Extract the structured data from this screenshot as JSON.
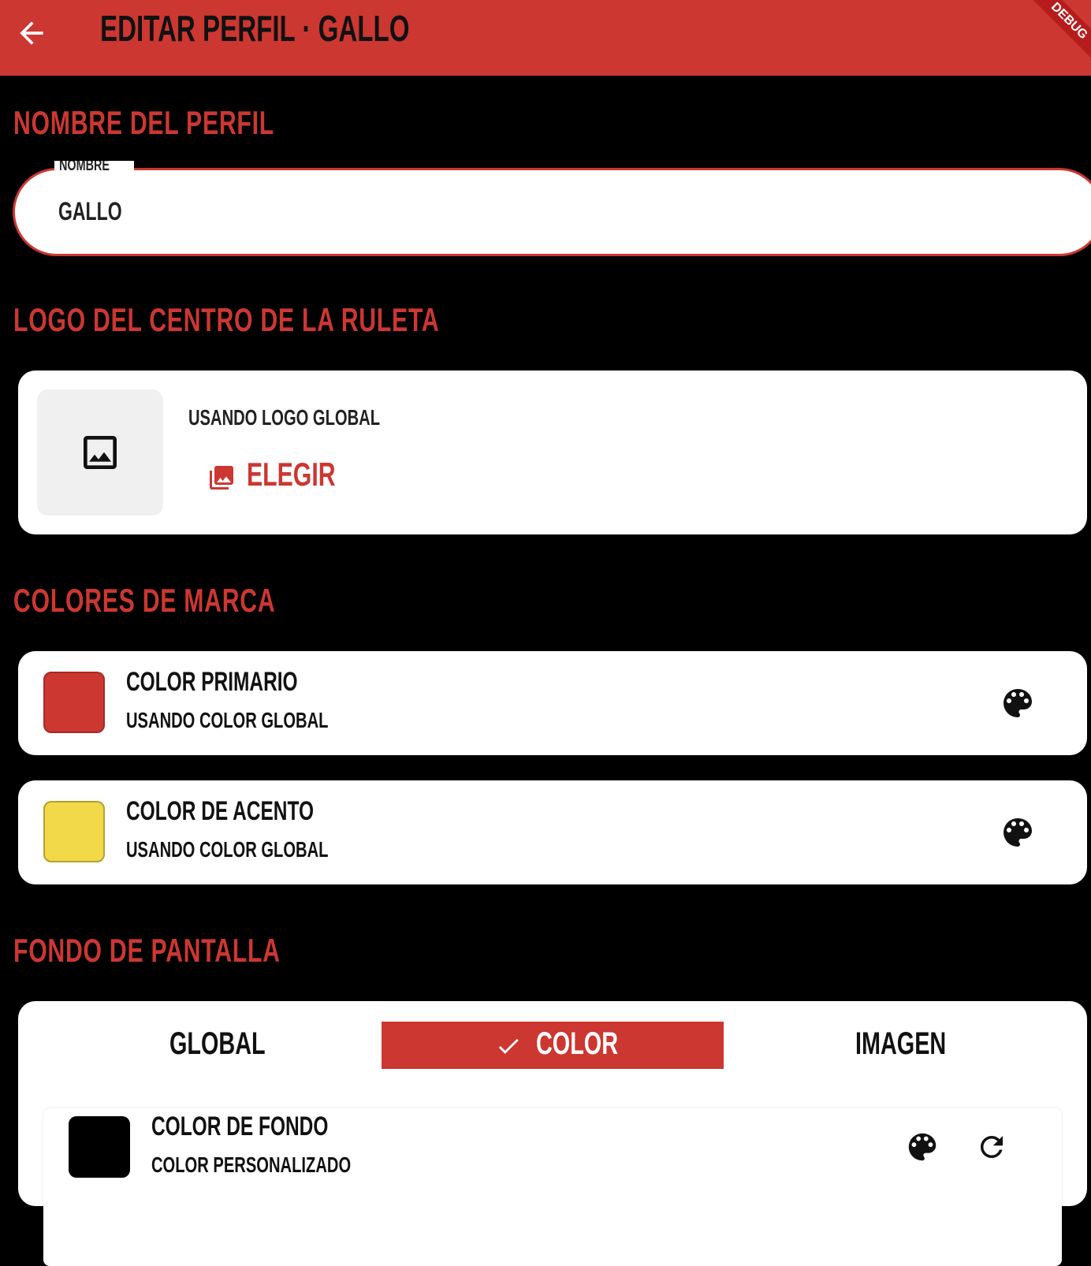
{
  "appbar": {
    "title": "EDITAR PERFIL · GALLO",
    "debug_banner": "DEBUG",
    "color": "#cc3731"
  },
  "sections": {
    "name": "NOMBRE DEL PERFIL",
    "logo": "LOGO DEL CENTRO DE LA RULETA",
    "colors": "COLORES DE MARCA",
    "background": "FONDO DE PANTALLA"
  },
  "name_field": {
    "label": "NOMBRE",
    "value": "GALLO"
  },
  "logo_card": {
    "status": "USANDO LOGO GLOBAL",
    "choose_label": "ELEGIR",
    "thumb_icon": "image-icon",
    "choose_icon": "photo-library-icon"
  },
  "primary_color": {
    "title": "COLOR PRIMARIO",
    "subtitle": "USANDO COLOR GLOBAL",
    "swatch": "#cc3731",
    "icon": "palette-icon"
  },
  "accent_color": {
    "title": "COLOR DE ACENTO",
    "subtitle": "USANDO COLOR GLOBAL",
    "swatch": "#f2d94a",
    "icon": "palette-icon"
  },
  "background": {
    "segments": [
      {
        "label": "GLOBAL",
        "selected": false
      },
      {
        "label": "COLOR",
        "selected": true,
        "icon": "check-icon"
      },
      {
        "label": "IMAGEN",
        "selected": false
      }
    ],
    "color_row": {
      "title": "COLOR DE FONDO",
      "subtitle": "COLOR PERSONALIZADO",
      "swatch": "#000000",
      "icons": [
        "palette-icon",
        "refresh-icon"
      ]
    }
  }
}
